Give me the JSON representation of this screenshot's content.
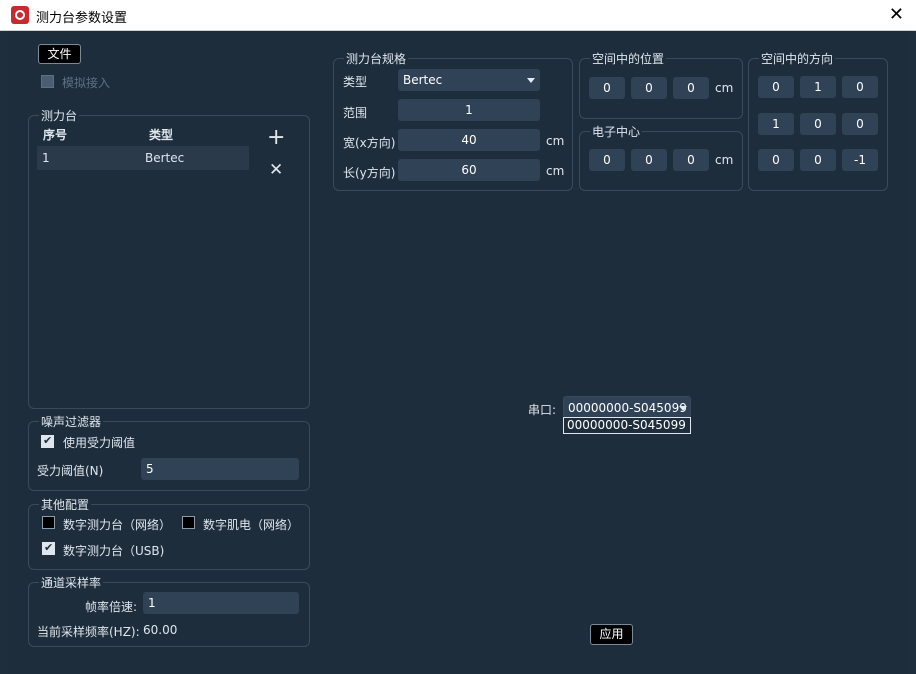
{
  "window": {
    "title": "测力台参数设置",
    "close_glyph": "✕"
  },
  "toolbar": {
    "file_label": "文件",
    "simulate_label": "模拟接入"
  },
  "plates": {
    "title": "测力台",
    "col_index": "序号",
    "col_type": "类型",
    "rows": [
      {
        "index": "1",
        "type": "Bertec"
      }
    ],
    "add_glyph": "+",
    "remove_glyph": "✕"
  },
  "noise": {
    "title": "噪声过滤器",
    "use_threshold_label": "使用受力阈值",
    "use_threshold": true,
    "threshold_label": "受力阈值(N)",
    "threshold_value": "5"
  },
  "other": {
    "title": "其他配置",
    "digital_net_label": "数字测力台（网络）",
    "digital_net": false,
    "emg_net_label": "数字肌电（网络）",
    "emg_net": false,
    "digital_usb_label": "数字测力台（USB)",
    "digital_usb": true
  },
  "sampling": {
    "title": "通道采样率",
    "multiplier_label": "帧率倍速:",
    "multiplier_value": "1",
    "current_label": "当前采样频率(HZ):",
    "current_value": "60.00"
  },
  "spec": {
    "title": "测力台规格",
    "type_label": "类型",
    "type_value": "Bertec",
    "range_label": "范围",
    "range_value": "1",
    "width_label": "宽(x方向)",
    "width_value": "40",
    "width_unit": "cm",
    "length_label": "长(y方向)",
    "length_value": "60",
    "length_unit": "cm"
  },
  "position": {
    "title": "空间中的位置",
    "values": [
      "0",
      "0",
      "0"
    ],
    "unit": "cm"
  },
  "electric_center": {
    "title": "电子中心",
    "values": [
      "0",
      "0",
      "0"
    ],
    "unit": "cm"
  },
  "orientation": {
    "title": "空间中的方向",
    "values": [
      [
        "0",
        "1",
        "0"
      ],
      [
        "1",
        "0",
        "0"
      ],
      [
        "0",
        "0",
        "-1"
      ]
    ]
  },
  "serial": {
    "label": "串口:",
    "selected": "00000000-S045099",
    "options": [
      "00000000-S045099"
    ]
  },
  "apply_label": "应用"
}
